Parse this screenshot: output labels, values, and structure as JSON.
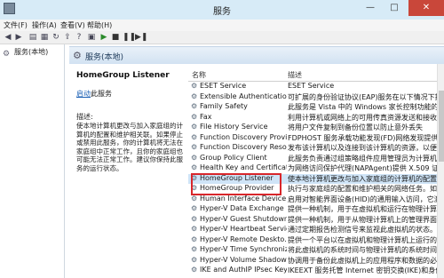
{
  "window": {
    "title": "服务",
    "minimize": "—",
    "maximize": "□",
    "close": "✕"
  },
  "menu": [
    "文件(F)",
    "操作(A)",
    "查看(V)",
    "帮助(H)"
  ],
  "tree": {
    "root": "服务(本地)"
  },
  "header": {
    "title": "服务(本地)"
  },
  "detail": {
    "service_name": "HomeGroup Listener",
    "start_link": "启动",
    "start_suffix": "此服务",
    "desc_label": "描述:",
    "desc_text": "使本地计算机更改与加入家庭组的计算机的配置和维护相关联。如果停止或禁用此服务，你的计算机将无法在家庭组中正常工作，且你的家庭组也可能无法正常工作。建议你保持此服务的运行状态。"
  },
  "columns": {
    "name": "名称",
    "desc": "描述"
  },
  "services": [
    {
      "name": "ESET Service",
      "desc": "ESET Service"
    },
    {
      "name": "Extensible Authentication...",
      "desc": "可扩展的身份验证协议(EAP)服务在以下情况下提供"
    },
    {
      "name": "Family Safety",
      "desc": "此服务是 Vista 中的 Windows 家长控制功能的存根"
    },
    {
      "name": "Fax",
      "desc": "利用计算机或网络上的可用传真资源发送和接收传真"
    },
    {
      "name": "File History Service",
      "desc": "将用户文件复制到备份位置以防止意外丢失"
    },
    {
      "name": "Function Discovery Provi...",
      "desc": "FDPHOST 服务承载功能发现(FD)网络发现提供程序"
    },
    {
      "name": "Function Discovery Reso...",
      "desc": "发布该计算机以及连接到该计算机的资源，以便能够"
    },
    {
      "name": "Group Policy Client",
      "desc": "此服务负责通过组策略组件应用管理员为计算机和用户"
    },
    {
      "name": "Health Key and Certificat...",
      "desc": "为网络访问保护代理(NAPAgent)提供 X.509 证书"
    },
    {
      "name": "HomeGroup Listener",
      "desc": "使本地计算机更改与加入家庭组的计算机的配置和维护"
    },
    {
      "name": "HomeGroup Provider",
      "desc": "执行与家庭组的配置和维护相关的网络任务。如果"
    },
    {
      "name": "Human Interface Device ...",
      "desc": "启用对智能界面设备(HID)的通用输入访问，它激活"
    },
    {
      "name": "Hyper-V Data Exchange ...",
      "desc": "提供一种机制，用于在虚拟机和运行在物理计算机上的"
    },
    {
      "name": "Hyper-V Guest Shutdown...",
      "desc": "提供一种机制，用于从物理计算机上的管理界面关闭"
    },
    {
      "name": "Hyper-V Heartbeat Service",
      "desc": "通过定期报告检测信号来监视此虚拟机的状态。此服务"
    },
    {
      "name": "Hyper-V Remote Deskto...",
      "desc": "提供一个平台以在虚拟机和物理计算机上运行的操作系"
    },
    {
      "name": "Hyper-V Time Synchroniz...",
      "desc": "将此虚拟机的系统时间与物理计算机的系统时间同步"
    },
    {
      "name": "Hyper-V Volume Shadow...",
      "desc": "协调用于备份此虚拟机上的应用程序和数据的必要操作"
    },
    {
      "name": "IKE and AuthIP IPsec Key...",
      "desc": "IKEEXT 服务托管 Internet 密钥交换(IKE)和身份"
    }
  ],
  "selected_index": 9
}
